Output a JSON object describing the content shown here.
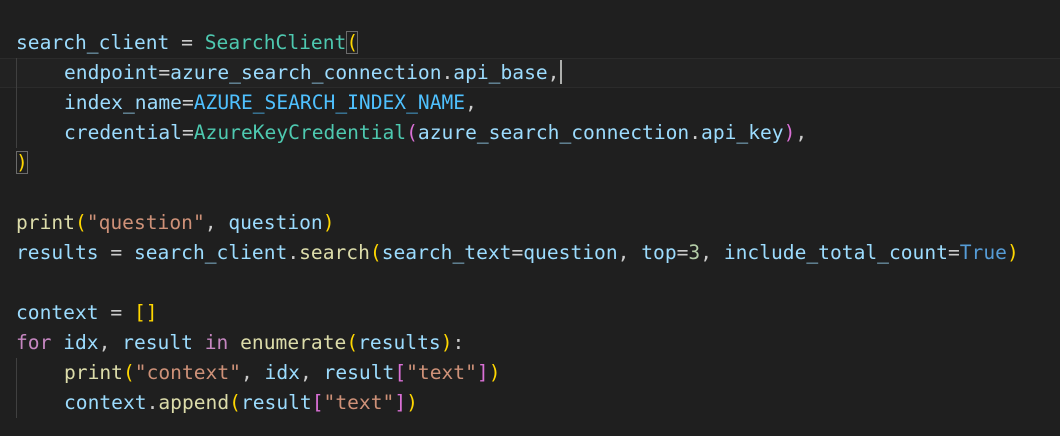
{
  "colors": {
    "background": "#1f1f1f",
    "variable": "#9cdcfe",
    "class": "#4ec9b0",
    "keyword": "#569cd6",
    "control_keyword": "#c586c0",
    "function": "#dcdcaa",
    "string": "#ce9178",
    "number": "#b5cea8",
    "bracket_level1": "#ffd700",
    "bracket_level2": "#da70d6",
    "bracket_level3": "#179fff"
  },
  "code": {
    "l1": {
      "var": "search_client",
      "op": " = ",
      "cls": "SearchClient",
      "open": "("
    },
    "l2": {
      "param": "endpoint",
      "eq": "=",
      "obj": "azure_search_connection",
      "dot": ".",
      "attr": "api_base",
      "comma": ","
    },
    "l3": {
      "param": "index_name",
      "eq": "=",
      "const": "AZURE_SEARCH_INDEX_NAME",
      "comma": ","
    },
    "l4": {
      "param": "credential",
      "eq": "=",
      "cls": "AzureKeyCredential",
      "open": "(",
      "obj": "azure_search_connection",
      "dot": ".",
      "attr": "api_key",
      "close": ")",
      "comma": ","
    },
    "l5": {
      "close": ")"
    },
    "l7": {
      "fn": "print",
      "open": "(",
      "str": "\"question\"",
      "comma": ", ",
      "arg": "question",
      "close": ")"
    },
    "l8": {
      "var": "results",
      "op": " = ",
      "obj": "search_client",
      "dot": ".",
      "fn": "search",
      "open": "(",
      "p1": "search_text",
      "eq1": "=",
      "v1": "question",
      "c1": ", ",
      "p2": "top",
      "eq2": "=",
      "v2": "3",
      "c2": ", ",
      "p3": "include_total_count",
      "eq3": "=",
      "v3": "True",
      "close": ")"
    },
    "l10": {
      "var": "context",
      "op": " = ",
      "list": "[]"
    },
    "l11": {
      "kw_for": "for",
      "sp1": " ",
      "v1": "idx",
      "c1": ", ",
      "v2": "result",
      "sp2": " ",
      "kw_in": "in",
      "sp3": " ",
      "fn": "enumerate",
      "open": "(",
      "arg": "results",
      "close": ")",
      "colon": ":"
    },
    "l12": {
      "fn": "print",
      "open": "(",
      "str1": "\"context\"",
      "c1": ", ",
      "v1": "idx",
      "c2": ", ",
      "v2": "result",
      "lb": "[",
      "str2": "\"text\"",
      "rb": "]",
      "close": ")"
    },
    "l13": {
      "obj": "context",
      "dot": ".",
      "fn": "append",
      "open": "(",
      "v": "result",
      "lb": "[",
      "str": "\"text\"",
      "rb": "]",
      "close": ")"
    }
  }
}
